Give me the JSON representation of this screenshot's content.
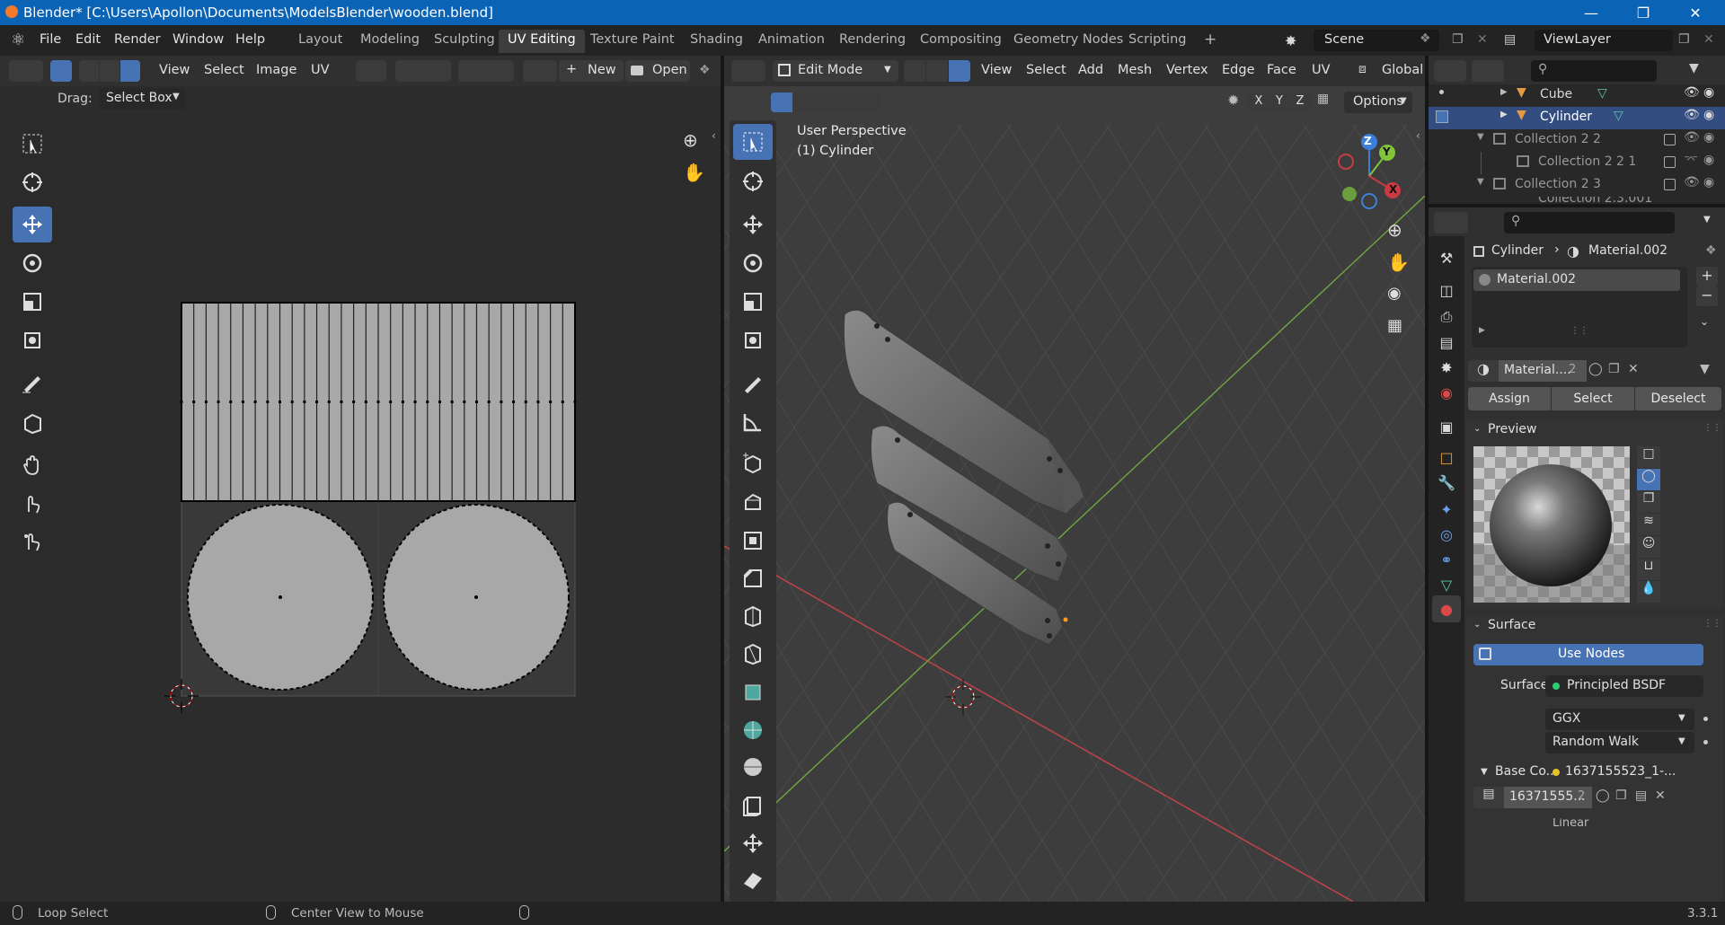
{
  "window": {
    "title": "Blender* [C:\\Users\\Apollon\\Documents\\ModelsBlender\\wooden.blend]"
  },
  "menu": [
    "File",
    "Edit",
    "Render",
    "Window",
    "Help"
  ],
  "workspaces": [
    "Layout",
    "Modeling",
    "Sculpting",
    "UV Editing",
    "Texture Paint",
    "Shading",
    "Animation",
    "Rendering",
    "Compositing",
    "Geometry Nodes",
    "Scripting"
  ],
  "active_workspace": "UV Editing",
  "add_workspace": "+",
  "scene": {
    "label": "Scene"
  },
  "view_layer": {
    "label": "ViewLayer"
  },
  "uv_editor": {
    "menus": [
      "View",
      "Select",
      "Image",
      "UV"
    ],
    "new_label": "New",
    "open_label": "Open",
    "drag_label": "Drag:",
    "drag_value": "Select Box"
  },
  "viewport": {
    "mode": "Edit Mode",
    "menus": [
      "View",
      "Select",
      "Add",
      "Mesh",
      "Vertex",
      "Edge",
      "Face",
      "UV"
    ],
    "orientation": "Global",
    "options_label": "Options",
    "axis_x": "X",
    "axis_y": "Y",
    "axis_z": "Z",
    "overlay_line1": "User Perspective",
    "overlay_line2": "(1) Cylinder",
    "gizmo": {
      "x": "X",
      "y": "Y",
      "z": "Z"
    }
  },
  "outliner": {
    "rows": [
      {
        "label": "Cube"
      },
      {
        "label": "Cylinder"
      },
      {
        "label": "Collection 2 2"
      },
      {
        "label": "Collection 2 2 1"
      },
      {
        "label": "Collection 2 3"
      }
    ],
    "partial_label": "Collection 2.3.001"
  },
  "properties": {
    "breadcrumb_object": "Cylinder",
    "breadcrumb_material": "Material.002",
    "slot_name": "Material.002",
    "material_name": "Material....",
    "material_users": "2",
    "assign": "Assign",
    "select": "Select",
    "deselect": "Deselect",
    "preview_label": "Preview",
    "surface_panel": "Surface",
    "use_nodes": "Use Nodes",
    "surface_label": "Surface",
    "surface_value": "Principled BSDF",
    "distribution": "GGX",
    "subsurface": "Random Walk",
    "base_color_label": "Base Co...",
    "base_color_value": "1637155523_1-...",
    "image_name": "16371555...",
    "image_users": "2",
    "bottom_partial": "Linear"
  },
  "status": {
    "item1": "Loop Select",
    "item2": "Center View to Mouse",
    "version": "3.3.1"
  },
  "colors": {
    "accent": "#4772b3",
    "titlebar": "#0b63b6",
    "x_axis": "#c93a42",
    "y_axis": "#80c43a",
    "z_axis": "#3b7fd8"
  }
}
